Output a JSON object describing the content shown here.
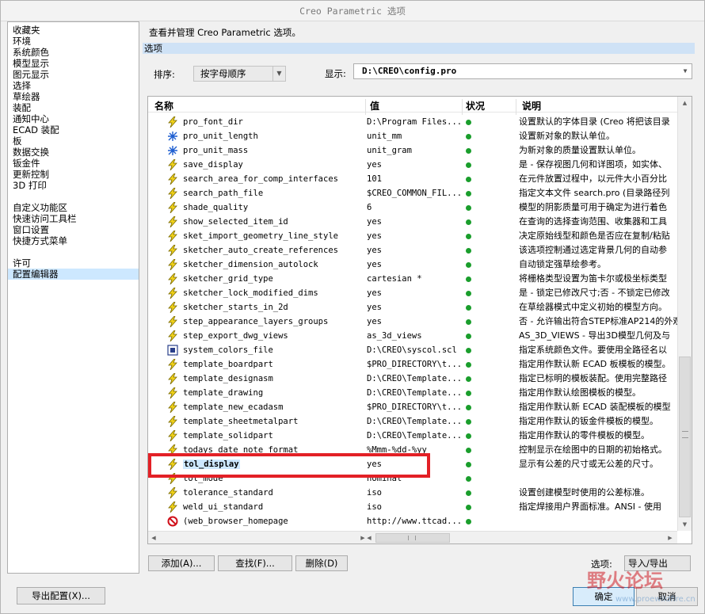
{
  "window": {
    "title": "Creo Parametric 选项"
  },
  "sidebar": {
    "group1": [
      "收藏夹",
      "环境",
      "系统颜色",
      "模型显示",
      "图元显示",
      "选择",
      "草绘器",
      "装配",
      "通知中心",
      "ECAD 装配",
      "板",
      "数据交换",
      "钣金件",
      "更新控制",
      "3D 打印"
    ],
    "group2": [
      "自定义功能区",
      "快速访问工具栏",
      "窗口设置",
      "快捷方式菜单"
    ],
    "group3": [
      "许可",
      "配置编辑器"
    ],
    "selected": "配置编辑器"
  },
  "main": {
    "description": "查看并管理 Creo Parametric 选项。",
    "section": "选项",
    "sort_label": "排序:",
    "sort_value": "按字母顺序",
    "show_label": "显示:",
    "show_value": "D:\\CREO\\config.pro"
  },
  "table": {
    "headers": {
      "name": "名称",
      "value": "值",
      "status": "状况",
      "desc": "说明"
    },
    "rows": [
      {
        "name": "pro_font_dir",
        "value": "D:\\Program Files...",
        "desc": "设置默认的字体目录 (Creo 将把该目录",
        "icon": "lightning"
      },
      {
        "name": "pro_unit_length",
        "value": "unit_mm",
        "desc": "设置新对象的默认单位。",
        "icon": "star"
      },
      {
        "name": "pro_unit_mass",
        "value": "unit_gram",
        "desc": "为新对象的质量设置默认单位。",
        "icon": "star"
      },
      {
        "name": "save_display",
        "value": "yes",
        "desc": "是 - 保存视图几何和详图项，如实体、",
        "icon": "lightning"
      },
      {
        "name": "search_area_for_comp_interfaces",
        "value": "101",
        "desc": "在元件放置过程中，以元件大小百分比",
        "icon": "lightning"
      },
      {
        "name": "search_path_file",
        "value": "$CREO_COMMON_FIL...",
        "desc": "指定文本文件 search.pro (目录路径列",
        "icon": "lightning"
      },
      {
        "name": "shade_quality",
        "value": "6",
        "desc": "模型的阴影质量可用于确定为进行着色",
        "icon": "lightning"
      },
      {
        "name": "show_selected_item_id",
        "value": "yes",
        "desc": "在查询的选择查询范围、收集器和工具",
        "icon": "lightning"
      },
      {
        "name": "sket_import_geometry_line_style",
        "value": "yes",
        "desc": "决定原始线型和颜色是否应在复制/粘贴",
        "icon": "lightning"
      },
      {
        "name": "sketcher_auto_create_references",
        "value": "yes",
        "desc": "该选项控制通过选定背景几何的自动参",
        "icon": "lightning"
      },
      {
        "name": "sketcher_dimension_autolock",
        "value": "yes",
        "desc": "自动锁定强草绘参考。",
        "icon": "lightning"
      },
      {
        "name": "sketcher_grid_type",
        "value": "cartesian *",
        "desc": "将栅格类型设置为笛卡尔或极坐标类型",
        "icon": "lightning"
      },
      {
        "name": "sketcher_lock_modified_dims",
        "value": "yes",
        "desc": "是 - 锁定已修改尺寸;否 - 不锁定已修改",
        "icon": "lightning"
      },
      {
        "name": "sketcher_starts_in_2d",
        "value": "yes",
        "desc": "在草绘器模式中定义初始的模型方向。",
        "icon": "lightning"
      },
      {
        "name": "step_appearance_layers_groups",
        "value": "yes",
        "desc": "否 - 允许输出符合STEP标准AP214的外观",
        "icon": "lightning"
      },
      {
        "name": "step_export_dwg_views",
        "value": "as_3d_views",
        "desc": "AS_3D_VIEWS - 导出3D模型几何及与",
        "icon": "lightning"
      },
      {
        "name": "system_colors_file",
        "value": "D:\\CREO\\syscol.scl",
        "desc": "指定系统颜色文件。要使用全路径名以",
        "icon": "file"
      },
      {
        "name": "template_boardpart",
        "value": "$PRO_DIRECTORY\\t...",
        "desc": "指定用作默认新 ECAD 板模板的模型。",
        "icon": "lightning"
      },
      {
        "name": "template_designasm",
        "value": "D:\\CREO\\Template...",
        "desc": "指定已标明的模板装配。使用完整路径",
        "icon": "lightning"
      },
      {
        "name": "template_drawing",
        "value": "D:\\CREO\\Template...",
        "desc": "指定用作默认绘图模板的模型。",
        "icon": "lightning"
      },
      {
        "name": "template_new_ecadasm",
        "value": "$PRO_DIRECTORY\\t...",
        "desc": "指定用作默认新 ECAD 装配模板的模型",
        "icon": "lightning"
      },
      {
        "name": "template_sheetmetalpart",
        "value": "D:\\CREO\\Template...",
        "desc": "指定用作默认的钣金件模板的模型。",
        "icon": "lightning"
      },
      {
        "name": "template_solidpart",
        "value": "D:\\CREO\\Template...",
        "desc": "指定用作默认的零件模板的模型。",
        "icon": "lightning"
      },
      {
        "name": "todays_date_note_format",
        "value": "%Mmm-%dd-%yy",
        "desc": "控制显示在绘图中的日期的初始格式。",
        "icon": "lightning"
      },
      {
        "name": "tol_display",
        "value": "yes",
        "desc": "显示有公差的尺寸或无公差的尺寸。",
        "icon": "lightning",
        "selected": true
      },
      {
        "name": "tol_mode",
        "value": "nominal",
        "desc": "",
        "icon": "lightning"
      },
      {
        "name": "tolerance_standard",
        "value": "iso",
        "desc": "设置创建模型时使用的公差标准。",
        "icon": "lightning"
      },
      {
        "name": "weld_ui_standard",
        "value": "iso",
        "desc": "指定焊接用户界面标准。ANSI - 使用",
        "icon": "lightning"
      },
      {
        "name": "(web_browser_homepage",
        "value": "http://www.ttcad...",
        "desc": "",
        "icon": "no"
      }
    ]
  },
  "buttons": {
    "add": "添加(A)...",
    "find": "查找(F)...",
    "delete": "删除(D)",
    "export": "导出配置(X)...",
    "options_label": "选项:",
    "import_export": "导入/导出",
    "ok": "确定",
    "cancel": "取消"
  },
  "watermark": {
    "text": "野火论坛",
    "url": "www.proewildfire.cn"
  },
  "colors": {
    "selection": "#cde8ff",
    "status_ok": "#1a9e2c",
    "highlight_box": "#e32026"
  }
}
